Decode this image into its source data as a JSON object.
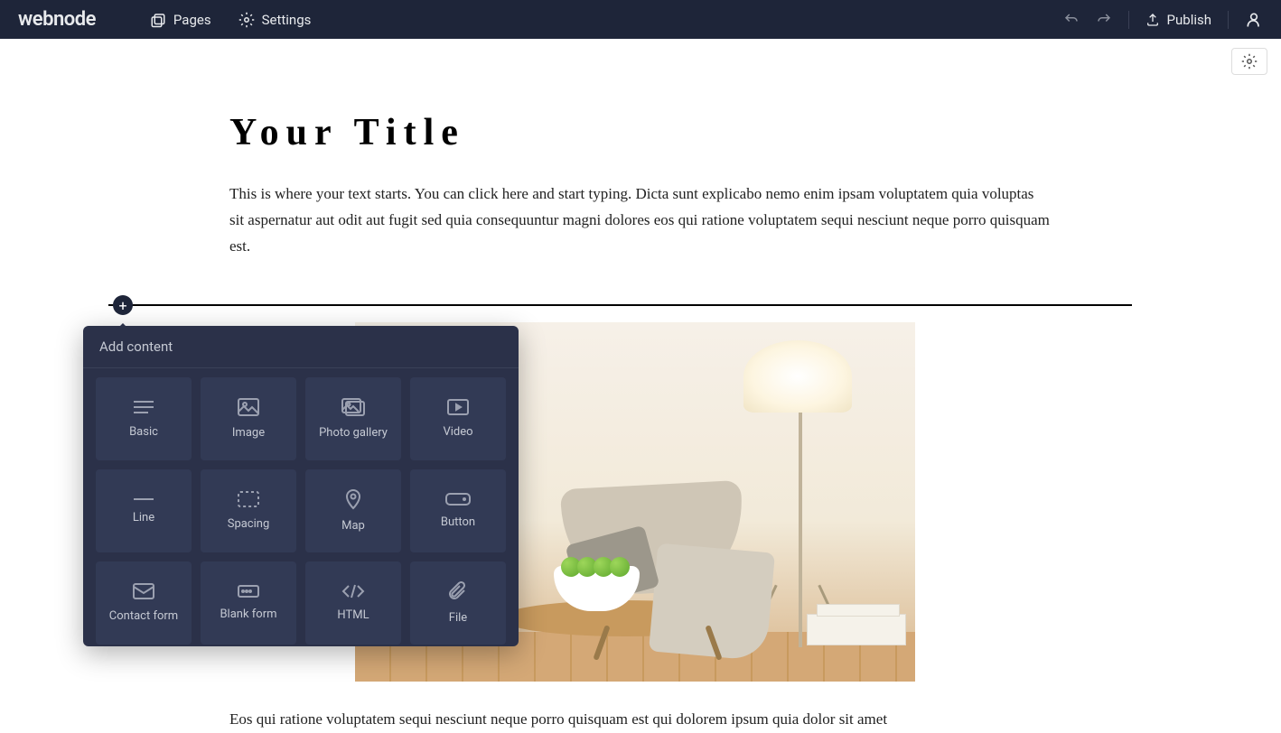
{
  "header": {
    "logo": "webnode",
    "nav": {
      "pages": "Pages",
      "settings": "Settings"
    },
    "publish": "Publish"
  },
  "page": {
    "title": "Your Title",
    "paragraph1": "This is where your text starts. You can click here and start typing. Dicta sunt explicabo nemo enim ipsam voluptatem quia voluptas sit aspernatur aut odit aut fugit sed quia consequuntur magni dolores eos qui ratione voluptatem sequi nesciunt neque porro quisquam est.",
    "paragraph2": "Eos qui ratione voluptatem sequi nesciunt neque porro quisquam est qui dolorem ipsum quia dolor sit amet"
  },
  "popup": {
    "title": "Add content",
    "tiles": {
      "basic": "Basic",
      "image": "Image",
      "photo_gallery": "Photo gallery",
      "video": "Video",
      "line": "Line",
      "spacing": "Spacing",
      "map": "Map",
      "button": "Button",
      "contact_form": "Contact form",
      "blank_form": "Blank form",
      "html": "HTML",
      "file": "File"
    }
  }
}
